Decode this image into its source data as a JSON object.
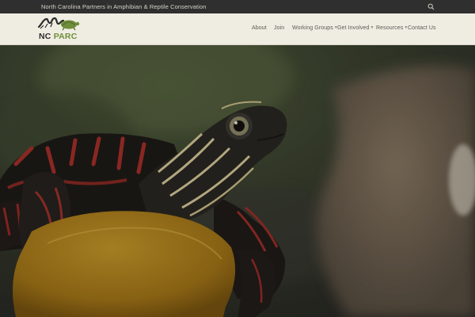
{
  "topbar": {
    "tagline": "North Carolina Partners in Amphibian & Reptile Conservation",
    "search_icon": "search-icon"
  },
  "logo": {
    "nc": "NC",
    "parc": "PARC",
    "icon": "salamander-turtle-logo-icon"
  },
  "nav": {
    "items": [
      {
        "label": "About",
        "dropdown": false
      },
      {
        "label": "Join",
        "dropdown": false
      },
      {
        "label": "Working Groups",
        "dropdown": true
      },
      {
        "label": "Get Involved",
        "dropdown": true
      },
      {
        "label": "Resources",
        "dropdown": true
      },
      {
        "label": "Contact Us",
        "dropdown": false
      }
    ],
    "dropdown_icon": "chevron-down-icon"
  },
  "hero": {
    "subject": "painted-turtle-photo"
  },
  "colors": {
    "topbar_bg": "#2f2f2f",
    "header_bg": "#efede2",
    "brand_green": "#6f8d3a",
    "nav_text": "#5a5a55"
  }
}
